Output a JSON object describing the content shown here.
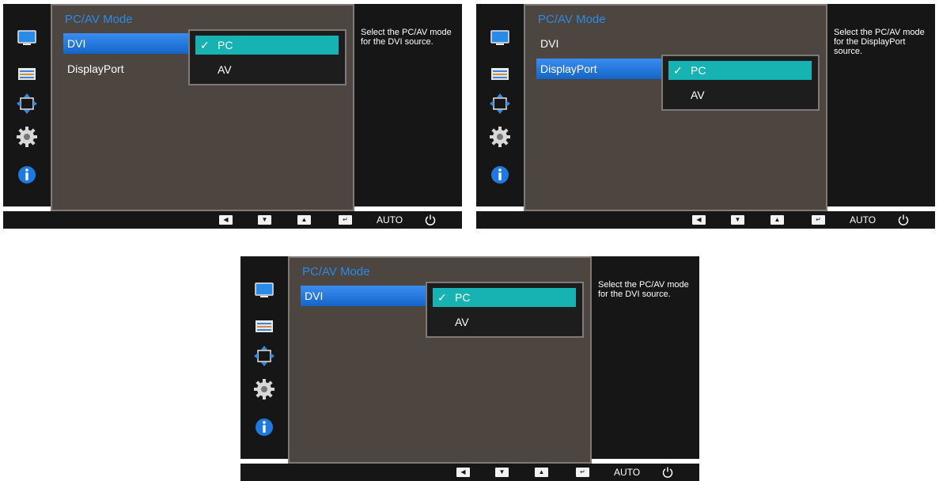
{
  "help_text": {
    "dvi": "Select the PC/AV mode for the DVI source.",
    "displayport": "Select the PC/AV mode for the DisplayPort source."
  },
  "menu": {
    "title": "PC/AV Mode",
    "dvi_label": "DVI",
    "displayport_label": "DisplayPort"
  },
  "submenu": {
    "check_glyph": "✓",
    "pc_label": "PC",
    "av_label": "AV"
  },
  "bottom_bar": {
    "left_glyph": "◀",
    "down_glyph": "▼",
    "up_glyph": "▲",
    "enter_glyph": "↵",
    "auto_label": "AUTO"
  },
  "colors": {
    "panel_bg": "#161616",
    "menu_bg": "#4c4540",
    "title_blue": "#2b8ae6",
    "selected_item_blue": "#1e78e0",
    "selected_option_teal": "#17b2b2"
  },
  "sidebar_icons": [
    "monitor-icon",
    "color-adjust-icon",
    "position-arrows-icon",
    "gear-icon",
    "info-icon"
  ]
}
